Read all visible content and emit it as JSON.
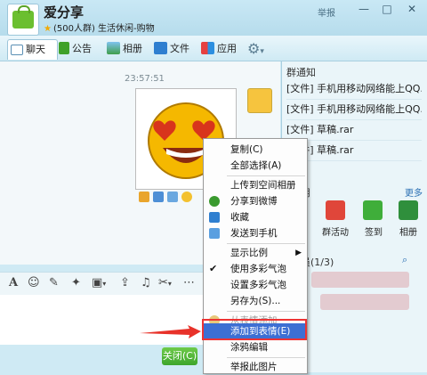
{
  "window": {
    "group_name": "爱分享",
    "group_sub": "(500人群) 生活休闲-购物",
    "report_label": "举报",
    "buttons": [
      "—",
      "□",
      "✕"
    ]
  },
  "tabs": [
    {
      "label": "聊天",
      "icon": "chat-icon"
    },
    {
      "label": "公告",
      "icon": "flag-icon"
    },
    {
      "label": "相册",
      "icon": "photo-icon"
    },
    {
      "label": "文件",
      "icon": "folder-icon"
    },
    {
      "label": "应用",
      "icon": "apps-icon"
    },
    {
      "label": "",
      "icon": "gear-icon"
    }
  ],
  "chat": {
    "timestamp": "23:57:51"
  },
  "input_toolbar": {
    "font_icon": "A",
    "tools": [
      "font-icon",
      "emoji-icon",
      "magic-icon",
      "shake-icon",
      "image-icon",
      "upload-icon",
      "music-icon",
      "scissors-icon",
      "more-icon"
    ]
  },
  "send": {
    "close_label": "关闭(C)"
  },
  "right_panel": {
    "notice_title": "群通知",
    "notices": [
      "[文件] 手机用移动网络能上QQ...",
      "[文件] 手机用移动网络能上QQ...",
      "[文件] 草稿.rar",
      "[文件] 草稿.rar"
    ],
    "apps_title": "用",
    "more_label": "更多",
    "apps": [
      "群活动",
      "签到",
      "相册"
    ],
    "members_title": "员(1/3)"
  },
  "context_menu": {
    "items": [
      {
        "label": "复制(C)",
        "state": "normal"
      },
      {
        "label": "全部选择(A)",
        "state": "normal"
      },
      {
        "label": "上传到空间相册",
        "state": "normal"
      },
      {
        "label": "分享到微博",
        "state": "normal"
      },
      {
        "label": "收藏",
        "state": "normal"
      },
      {
        "label": "发送到手机",
        "state": "normal"
      },
      {
        "label": "显示比例",
        "state": "submenu"
      },
      {
        "label": "使用多彩气泡",
        "state": "checked"
      },
      {
        "label": "设置多彩气泡",
        "state": "normal"
      },
      {
        "label": "另存为(S)...",
        "state": "normal"
      },
      {
        "label": "从表情添加",
        "state": "disabled"
      },
      {
        "label": "添加到表情(E)",
        "state": "selected"
      },
      {
        "label": "涂鸦编辑",
        "state": "normal"
      },
      {
        "label": "举报此图片",
        "state": "normal"
      }
    ]
  },
  "colors": {
    "selected_menu": "#3d6fd3",
    "highlight_box": "#ee3333",
    "close_button": "#3da52b"
  }
}
